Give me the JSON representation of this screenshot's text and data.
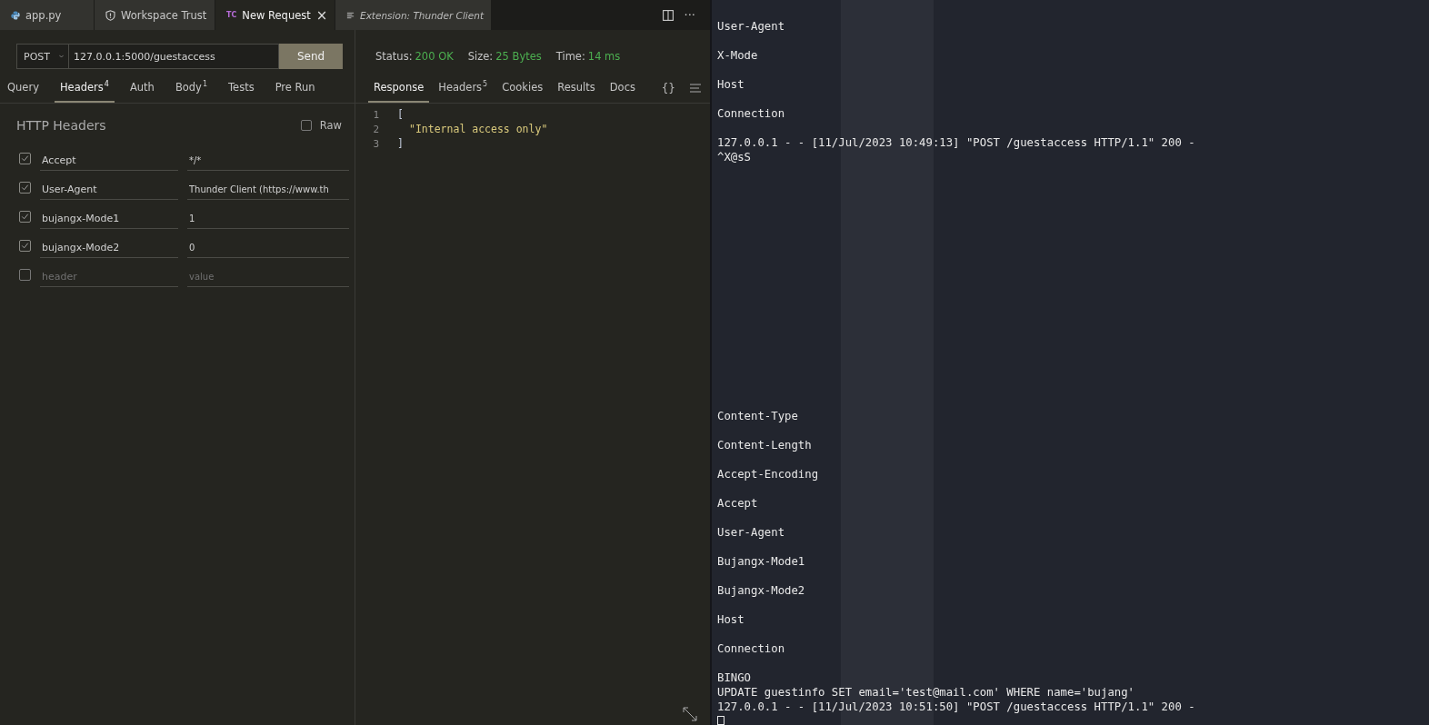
{
  "editor_tabs": [
    {
      "label": "app.py",
      "italic": false,
      "selected": false
    },
    {
      "label": "Workspace Trust",
      "italic": false,
      "selected": false
    },
    {
      "label": "New Request",
      "badge": "TC",
      "italic": false,
      "selected": true,
      "close": "×"
    },
    {
      "label": "Extension: Thunder Client",
      "italic": true,
      "selected": false
    }
  ],
  "editor_actions": {
    "more": "···"
  },
  "request": {
    "method": "POST",
    "url": "127.0.0.1:5000/guestaccess",
    "send": "Send"
  },
  "request_tabs": [
    {
      "label": "Query",
      "selected": false
    },
    {
      "label": "Headers",
      "count": "4",
      "selected": true
    },
    {
      "label": "Auth",
      "selected": false
    },
    {
      "label": "Body",
      "count": "1",
      "selected": false
    },
    {
      "label": "Tests",
      "selected": false
    },
    {
      "label": "Pre Run",
      "selected": false
    }
  ],
  "headers_section": {
    "title": "HTTP Headers",
    "raw_label": "Raw",
    "raw_checked": false
  },
  "headers": [
    {
      "checked": true,
      "name": "Accept",
      "value": "*/*"
    },
    {
      "checked": true,
      "name": "User-Agent",
      "value": "Thunder Client (https://www.th"
    },
    {
      "checked": true,
      "name": "bujangx-Mode1",
      "value": "1"
    },
    {
      "checked": true,
      "name": "bujangx-Mode2",
      "value": "0"
    },
    {
      "checked": false,
      "name_placeholder": "header",
      "value_placeholder": "value"
    }
  ],
  "response": {
    "status_label": "Status:",
    "status": "200 OK",
    "size_label": "Size:",
    "size": "25 Bytes",
    "time_label": "Time:",
    "time": "14 ms"
  },
  "response_tabs": [
    {
      "label": "Response",
      "selected": true
    },
    {
      "label": "Headers",
      "count": "5",
      "selected": false
    },
    {
      "label": "Cookies",
      "selected": false
    },
    {
      "label": "Results",
      "selected": false
    },
    {
      "label": "Docs",
      "selected": false
    }
  ],
  "response_actions": {
    "braces": "{}"
  },
  "response_body": [
    {
      "number": "1",
      "text": "[",
      "kind": "punct"
    },
    {
      "number": "2",
      "text": "\"Internal access only\"",
      "kind": "string"
    },
    {
      "number": "3",
      "text": "]",
      "kind": "punct"
    }
  ],
  "terminal": {
    "top_output": [
      [
        "User-Agent"
      ],
      [
        "X-Mode"
      ],
      [
        "Host"
      ],
      [
        "Connection"
      ],
      [
        "127.0.0.1 - - [11/Jul/2023 10:49:13] \"POST /guestaccess HTTP/1.1\" 200 -",
        "^X@sS"
      ]
    ],
    "bottom_output": [
      [
        "Content-Type"
      ],
      [
        "Content-Length"
      ],
      [
        "Accept-Encoding"
      ],
      [
        "Accept"
      ],
      [
        "User-Agent"
      ],
      [
        "Bujangx-Mode1"
      ],
      [
        "Bujangx-Mode2"
      ],
      [
        "Host"
      ],
      [
        "Connection"
      ],
      [
        "BINGO",
        "UPDATE guestinfo SET email='test@mail.com' WHERE name='bujang'",
        "127.0.0.1 - - [11/Jul/2023 10:51:50] \"POST /guestaccess HTTP/1.1\" 200 -"
      ]
    ],
    "cursor": true
  }
}
